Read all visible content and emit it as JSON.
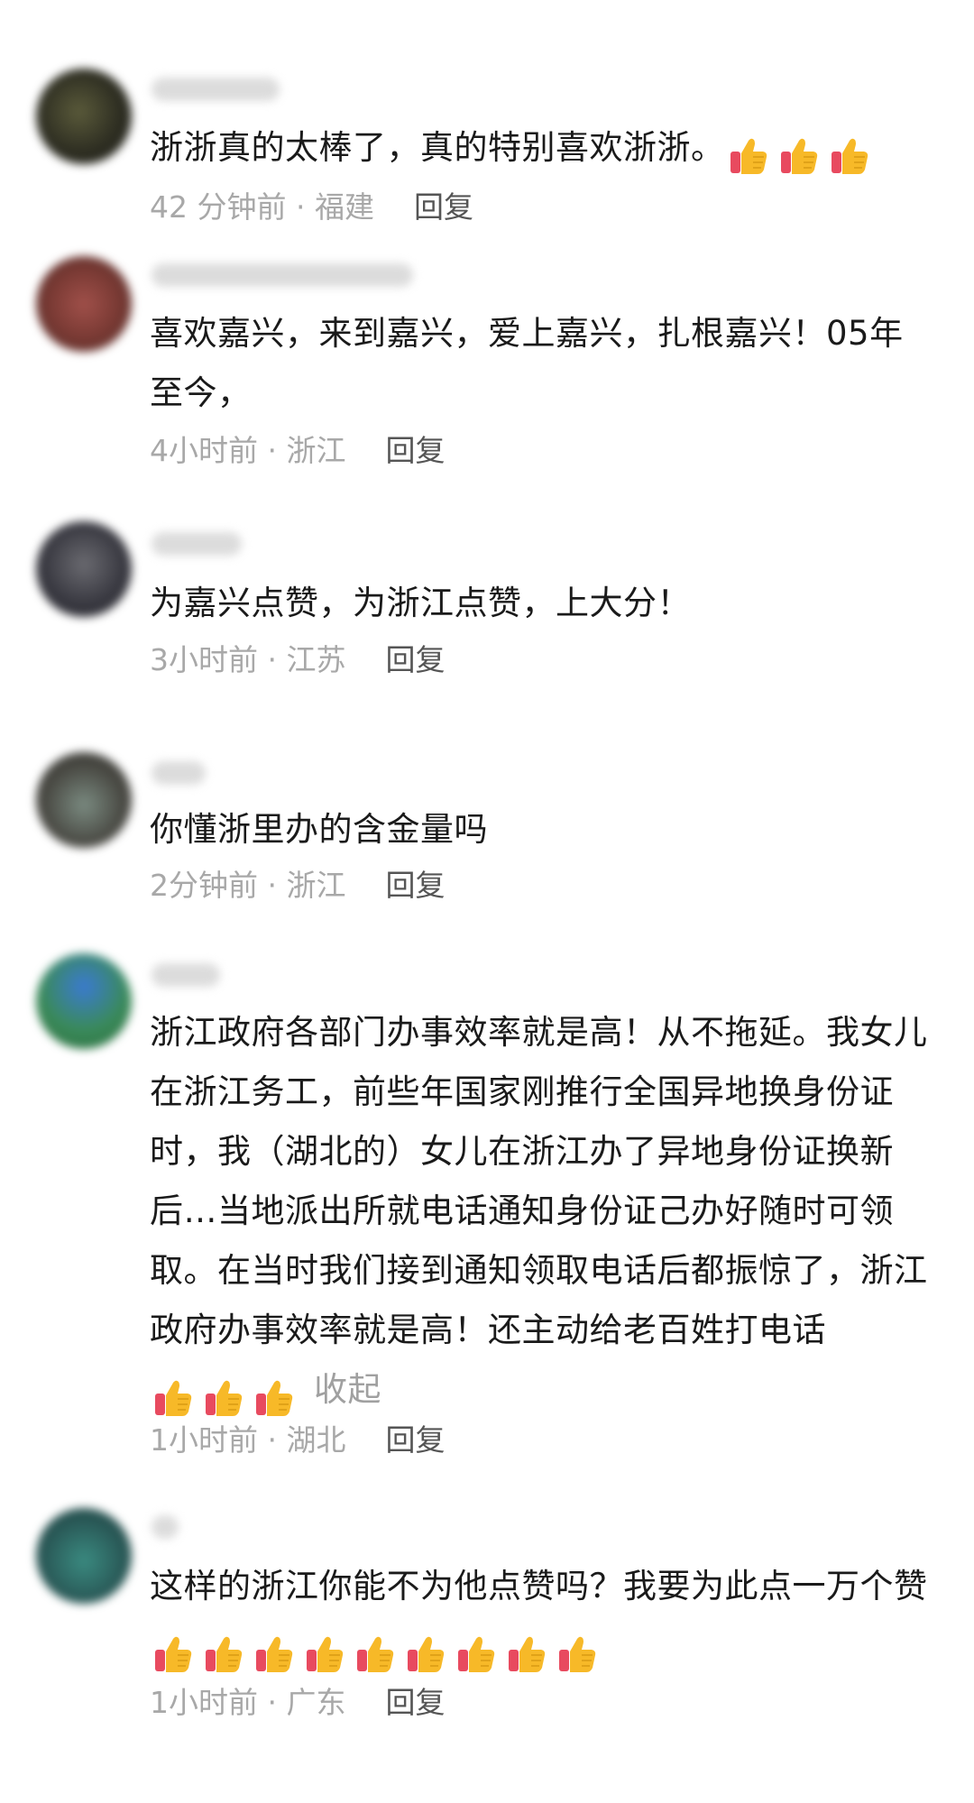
{
  "comments": [
    {
      "text": "浙浙真的太棒了，真的特别喜欢浙浙。",
      "time": "42 分钟前 · 福建",
      "reply": "回复",
      "thumbs": 3
    },
    {
      "text": "喜欢嘉兴，来到嘉兴，爱上嘉兴，扎根嘉兴！05年至今，",
      "time": "4小时前 · 浙江",
      "reply": "回复",
      "thumbs": 0
    },
    {
      "text": "为嘉兴点赞，为浙江点赞，上大分！",
      "time": "3小时前 · 江苏",
      "reply": "回复",
      "thumbs": 0
    },
    {
      "text": "你懂浙里办的含金量吗",
      "time": "2分钟前 · 浙江",
      "reply": "回复",
      "thumbs": 0
    },
    {
      "text": "浙江政府各部门办事效率就是高！从不拖延。我女儿在浙江务工，前些年国家刚推行全国异地换身份证时，我（湖北的）女儿在浙江办了异地身份证换新后…当地派出所就电话通知身份证己办好随时可领取。在当时我们接到通知领取电话后都振惊了，浙江政府办事效率就是高！还主动给老百姓打电话",
      "time": "1小时前 · 湖北",
      "reply": "回复",
      "thumbs": 3,
      "collapse": "收起"
    },
    {
      "text": "这样的浙江你能不为他点赞吗？我要为此点一万个赞",
      "time": "1小时前 · 广东",
      "reply": "回复",
      "thumbs": 9
    }
  ],
  "icons": {
    "thumb": "thumbs-up-icon",
    "thumb_color": "#f7b928",
    "cuff_color": "#e84a5f"
  }
}
